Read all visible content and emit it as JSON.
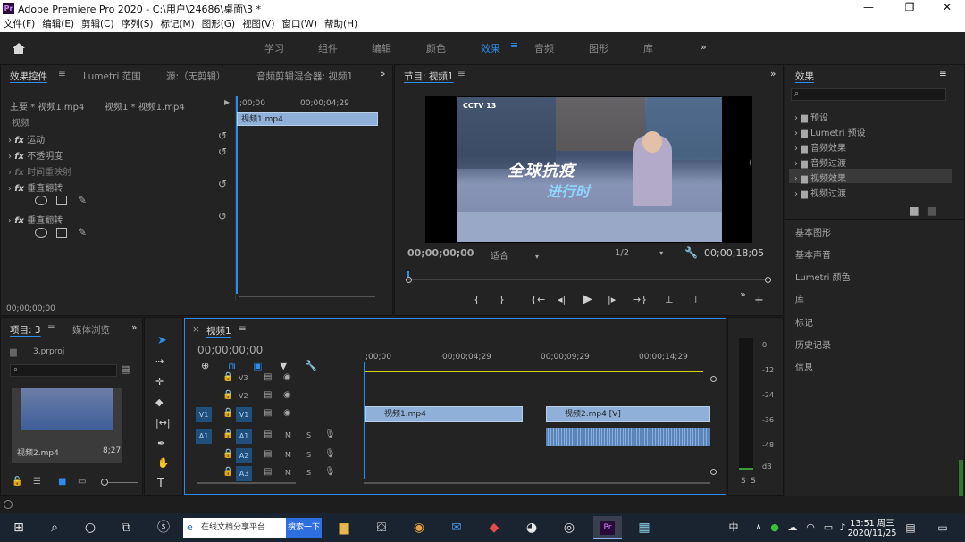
{
  "window": {
    "title": "Adobe Premiere Pro 2020 - C:\\用户\\24686\\桌面\\3 *",
    "logo": "Pr",
    "controls": [
      "—",
      "❐",
      "✕"
    ]
  },
  "menu": [
    "文件(F)",
    "编辑(E)",
    "剪辑(C)",
    "序列(S)",
    "标记(M)",
    "图形(G)",
    "视图(V)",
    "窗口(W)",
    "帮助(H)"
  ],
  "workspaces": {
    "items": [
      "学习",
      "组件",
      "编辑",
      "颜色",
      "效果",
      "音频",
      "图形",
      "库"
    ],
    "active": "效果",
    "more": "»"
  },
  "effect_controls": {
    "tabs": [
      "效果控件",
      "Lumetri 范围",
      "源:（无剪辑）",
      "音频剪辑混合器: 视频1"
    ],
    "source_label": "主要 * 视频1.mp4",
    "clip_label": "视频1 * 视频1.mp4",
    "section": "视频",
    "effects": [
      "运动",
      "不透明度",
      "时间重映射",
      "垂直翻转",
      "垂直翻转"
    ],
    "timecode": "00;00;00;00",
    "mini_timeline": {
      "start": ";00;00",
      "mid": "00;00;04;29",
      "clip": "视频1.mp4"
    }
  },
  "program_monitor": {
    "title": "节目: 视频1",
    "timecode": "00;00;00;00",
    "fit": "适合",
    "resolution": "1/2",
    "duration": "00;00;18;05",
    "video_caption1": "全球抗疫",
    "video_caption2": "进行时",
    "channel": "CCTV 13"
  },
  "effects_panel": {
    "title": "效果",
    "folders": [
      "预设",
      "Lumetri 预设",
      "音频效果",
      "音频过渡",
      "视频效果",
      "视频过渡"
    ],
    "sections": [
      "基本图形",
      "基本声音",
      "Lumetri 颜色",
      "库",
      "标记",
      "历史记录",
      "信息"
    ]
  },
  "project_panel": {
    "tabs": [
      "项目: 3",
      "媒体浏览"
    ],
    "file": "3.prproj",
    "clip_name": "视频2.mp4",
    "clip_duration": "8;27"
  },
  "timeline": {
    "sequence": "视频1",
    "timecode": "00;00;00;00",
    "ruler": [
      ";00;00",
      "00;00;04;29",
      "00;00;09;29",
      "00;00;14;29"
    ],
    "video_tracks": [
      "V3",
      "V2",
      "V1"
    ],
    "audio_tracks": [
      "A1",
      "A2",
      "A3"
    ],
    "source_v": "V1",
    "source_a": "A1",
    "track_m": "M",
    "track_s": "S",
    "clips": [
      {
        "label": "视频1.mp4",
        "track": "V1",
        "start": 0,
        "end": 5.9
      },
      {
        "label": "视频2.mp4 [V]",
        "track": "V1",
        "start": 6.8,
        "end": 13.4
      }
    ]
  },
  "audio_meter": {
    "levels": [
      "0",
      "-12",
      "-24",
      "-36",
      "-48",
      "dB"
    ],
    "solo": [
      "S",
      "S"
    ]
  },
  "taskbar": {
    "search_text": "在线文档分享平台",
    "search_button": "搜索一下",
    "ime": "中",
    "time": "13:51 周三",
    "date": "2020/11/25"
  },
  "colors": {
    "accent": "#2d8ceb",
    "clip_video": "#8fb1d9",
    "clip_audio": "#5b85b8",
    "track_button": "#1f4f7a"
  }
}
